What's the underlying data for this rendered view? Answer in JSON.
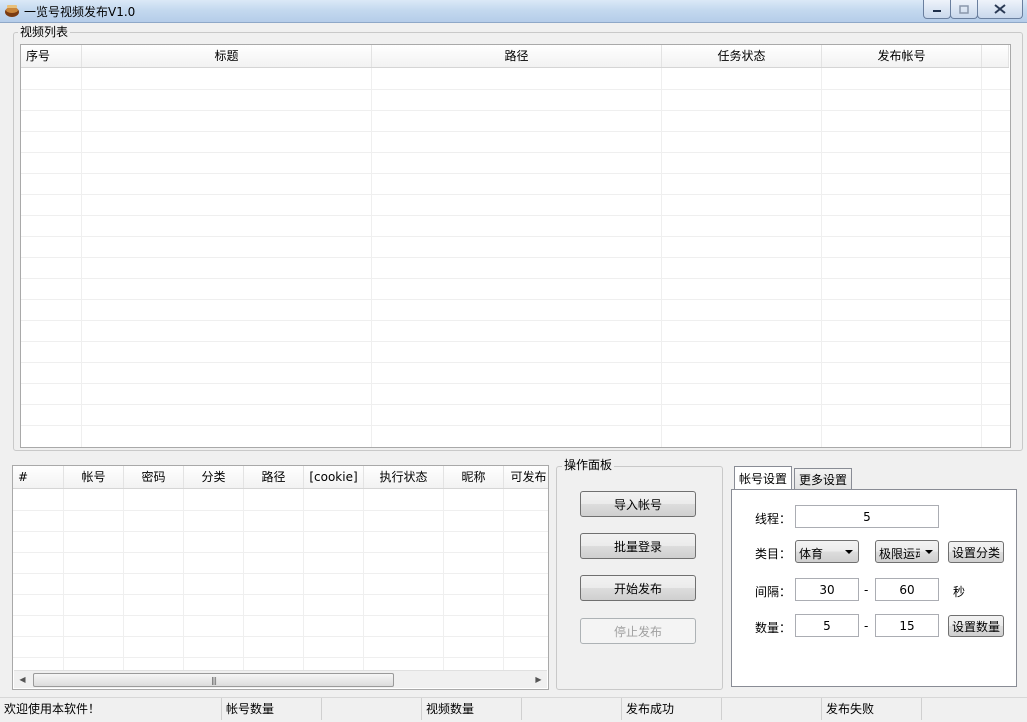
{
  "window": {
    "title": "一览号视频发布V1.0"
  },
  "video_list": {
    "caption": "视频列表",
    "columns": [
      "序号",
      "标题",
      "路径",
      "任务状态",
      "发布帐号"
    ],
    "rows": []
  },
  "account_list": {
    "columns": [
      "#",
      "帐号",
      "密码",
      "分类",
      "路径",
      "[cookie]",
      "执行状态",
      "昵称",
      "可发布"
    ],
    "rows": []
  },
  "operations": {
    "caption": "操作面板",
    "import_accounts": "导入帐号",
    "batch_login": "批量登录",
    "start_publish": "开始发布",
    "stop_publish": "停止发布"
  },
  "settings": {
    "tabs": [
      "帐号设置",
      "更多设置"
    ],
    "active_tab": "帐号设置",
    "threads_label": "线程：",
    "threads_value": "5",
    "category_label": "类目：",
    "category_value": "体育",
    "subcategory_value": "极限运动",
    "set_category_button": "设置分类",
    "interval_label": "间隔：",
    "interval_min": "30",
    "interval_dash": "-",
    "interval_max": "60",
    "interval_unit": "秒",
    "count_label": "数量：",
    "count_min": "5",
    "count_dash": "-",
    "count_max": "15",
    "set_count_button": "设置数量"
  },
  "status_bar": {
    "welcome": "欢迎使用本软件！",
    "account_count": "帐号数量",
    "video_count": "视频数量",
    "publish_success": "发布成功",
    "publish_failed": "发布失败"
  }
}
